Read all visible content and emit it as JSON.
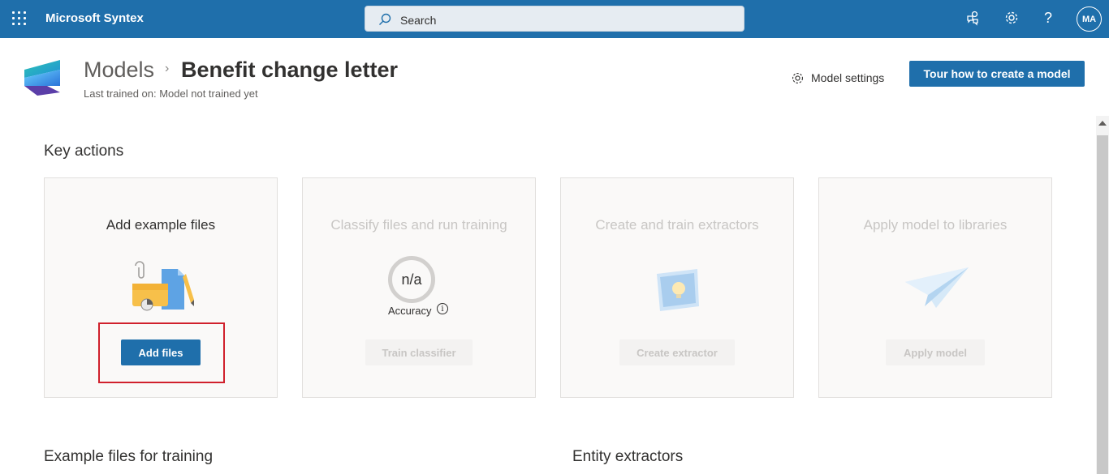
{
  "app": {
    "name": "Microsoft Syntex"
  },
  "search": {
    "placeholder": "Search"
  },
  "user": {
    "initials": "MA"
  },
  "header": {
    "breadcrumb_root": "Models",
    "title": "Benefit change letter",
    "last_trained": "Last trained on: Model not trained yet",
    "model_settings": "Model settings",
    "tour_button": "Tour how to create a model"
  },
  "key_actions": {
    "heading": "Key actions",
    "cards": [
      {
        "title": "Add example files",
        "button": "Add files",
        "enabled": true
      },
      {
        "title": "Classify files and run training",
        "button": "Train classifier",
        "enabled": false,
        "accuracy_value": "n/a",
        "accuracy_label": "Accuracy"
      },
      {
        "title": "Create and train extractors",
        "button": "Create extractor",
        "enabled": false
      },
      {
        "title": "Apply model to libraries",
        "button": "Apply model",
        "enabled": false
      }
    ]
  },
  "sections": {
    "example_files": "Example files for training",
    "entity_extractors": "Entity extractors"
  },
  "colors": {
    "brand": "#1f6fab",
    "highlight": "#d0202c"
  }
}
